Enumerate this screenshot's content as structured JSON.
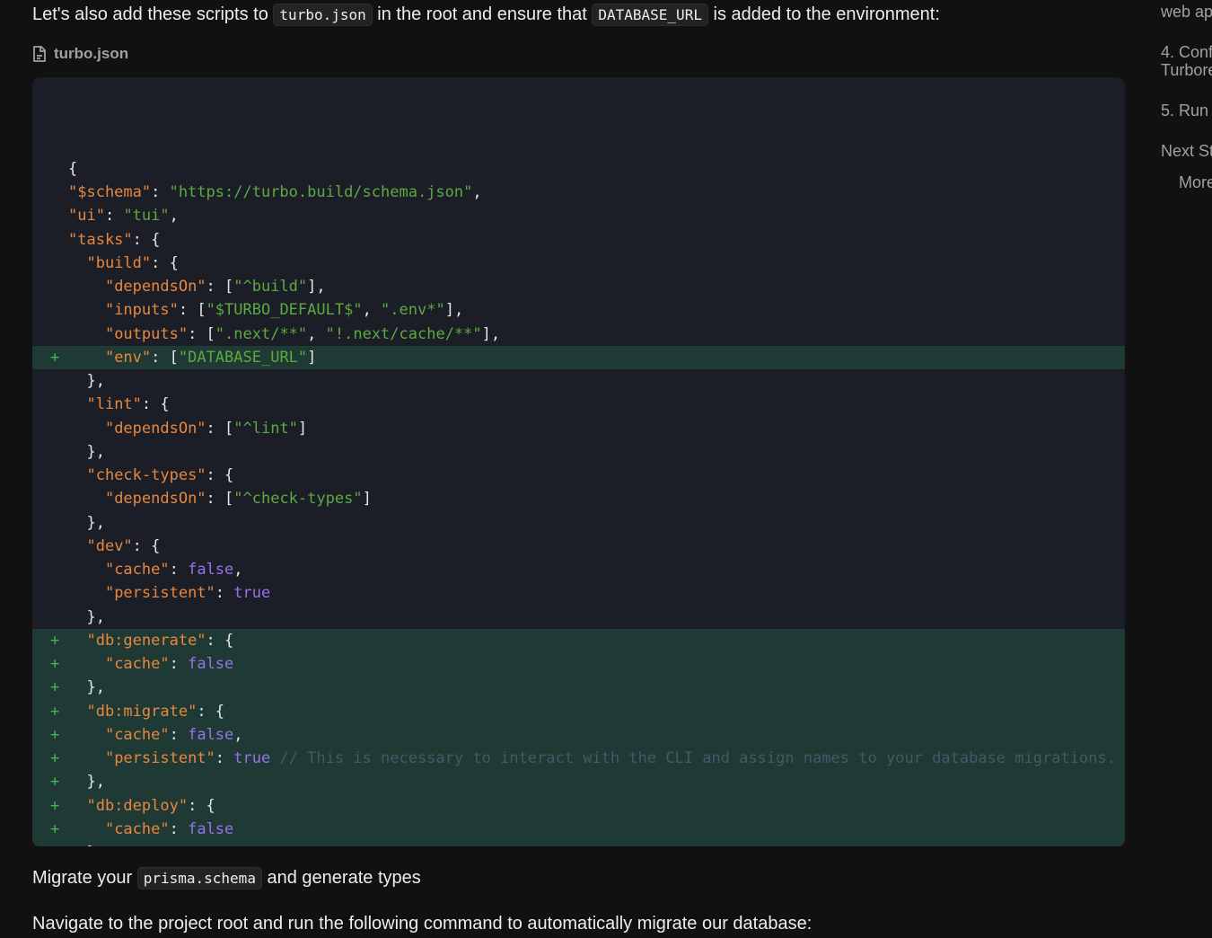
{
  "intro": {
    "before": "Let's also add these scripts to ",
    "code1": "turbo.json",
    "middle": " in the root and ensure that ",
    "code2": "DATABASE_URL",
    "after": " is added to the environment:"
  },
  "file": {
    "icon": "file-icon",
    "name": "turbo.json"
  },
  "code": [
    {
      "added": false,
      "tokens": [
        {
          "t": "p",
          "v": "{"
        }
      ]
    },
    {
      "added": false,
      "tokens": [
        {
          "t": "k",
          "v": "\"$schema\""
        },
        {
          "t": "p",
          "v": ": "
        },
        {
          "t": "s",
          "v": "\"https://turbo.build/schema.json\""
        },
        {
          "t": "p",
          "v": ","
        }
      ]
    },
    {
      "added": false,
      "tokens": [
        {
          "t": "k",
          "v": "\"ui\""
        },
        {
          "t": "p",
          "v": ": "
        },
        {
          "t": "s",
          "v": "\"tui\""
        },
        {
          "t": "p",
          "v": ","
        }
      ]
    },
    {
      "added": false,
      "tokens": [
        {
          "t": "k",
          "v": "\"tasks\""
        },
        {
          "t": "p",
          "v": ": {"
        }
      ]
    },
    {
      "added": false,
      "tokens": [
        {
          "t": "p",
          "v": "  "
        },
        {
          "t": "k",
          "v": "\"build\""
        },
        {
          "t": "p",
          "v": ": {"
        }
      ]
    },
    {
      "added": false,
      "tokens": [
        {
          "t": "p",
          "v": "    "
        },
        {
          "t": "k",
          "v": "\"dependsOn\""
        },
        {
          "t": "p",
          "v": ": ["
        },
        {
          "t": "s",
          "v": "\"^build\""
        },
        {
          "t": "p",
          "v": "],"
        }
      ]
    },
    {
      "added": false,
      "tokens": [
        {
          "t": "p",
          "v": "    "
        },
        {
          "t": "k",
          "v": "\"inputs\""
        },
        {
          "t": "p",
          "v": ": ["
        },
        {
          "t": "s",
          "v": "\"$TURBO_DEFAULT$\""
        },
        {
          "t": "p",
          "v": ", "
        },
        {
          "t": "s",
          "v": "\".env*\""
        },
        {
          "t": "p",
          "v": "],"
        }
      ]
    },
    {
      "added": false,
      "tokens": [
        {
          "t": "p",
          "v": "    "
        },
        {
          "t": "k",
          "v": "\"outputs\""
        },
        {
          "t": "p",
          "v": ": ["
        },
        {
          "t": "s",
          "v": "\".next/**\""
        },
        {
          "t": "p",
          "v": ", "
        },
        {
          "t": "s",
          "v": "\"!.next/cache/**\""
        },
        {
          "t": "p",
          "v": "],"
        }
      ]
    },
    {
      "added": true,
      "tokens": [
        {
          "t": "p",
          "v": "    "
        },
        {
          "t": "k",
          "v": "\"env\""
        },
        {
          "t": "p",
          "v": ": ["
        },
        {
          "t": "s",
          "v": "\"DATABASE_URL\""
        },
        {
          "t": "p",
          "v": "]"
        }
      ]
    },
    {
      "added": false,
      "tokens": [
        {
          "t": "p",
          "v": "  },"
        }
      ]
    },
    {
      "added": false,
      "tokens": [
        {
          "t": "p",
          "v": "  "
        },
        {
          "t": "k",
          "v": "\"lint\""
        },
        {
          "t": "p",
          "v": ": {"
        }
      ]
    },
    {
      "added": false,
      "tokens": [
        {
          "t": "p",
          "v": "    "
        },
        {
          "t": "k",
          "v": "\"dependsOn\""
        },
        {
          "t": "p",
          "v": ": ["
        },
        {
          "t": "s",
          "v": "\"^lint\""
        },
        {
          "t": "p",
          "v": "]"
        }
      ]
    },
    {
      "added": false,
      "tokens": [
        {
          "t": "p",
          "v": "  },"
        }
      ]
    },
    {
      "added": false,
      "tokens": [
        {
          "t": "p",
          "v": "  "
        },
        {
          "t": "k",
          "v": "\"check-types\""
        },
        {
          "t": "p",
          "v": ": {"
        }
      ]
    },
    {
      "added": false,
      "tokens": [
        {
          "t": "p",
          "v": "    "
        },
        {
          "t": "k",
          "v": "\"dependsOn\""
        },
        {
          "t": "p",
          "v": ": ["
        },
        {
          "t": "s",
          "v": "\"^check-types\""
        },
        {
          "t": "p",
          "v": "]"
        }
      ]
    },
    {
      "added": false,
      "tokens": [
        {
          "t": "p",
          "v": "  },"
        }
      ]
    },
    {
      "added": false,
      "tokens": [
        {
          "t": "p",
          "v": "  "
        },
        {
          "t": "k",
          "v": "\"dev\""
        },
        {
          "t": "p",
          "v": ": {"
        }
      ]
    },
    {
      "added": false,
      "tokens": [
        {
          "t": "p",
          "v": "    "
        },
        {
          "t": "k",
          "v": "\"cache\""
        },
        {
          "t": "p",
          "v": ": "
        },
        {
          "t": "kw",
          "v": "false"
        },
        {
          "t": "p",
          "v": ","
        }
      ]
    },
    {
      "added": false,
      "tokens": [
        {
          "t": "p",
          "v": "    "
        },
        {
          "t": "k",
          "v": "\"persistent\""
        },
        {
          "t": "p",
          "v": ": "
        },
        {
          "t": "kw",
          "v": "true"
        }
      ]
    },
    {
      "added": false,
      "tokens": [
        {
          "t": "p",
          "v": "  },"
        }
      ]
    },
    {
      "added": true,
      "tokens": [
        {
          "t": "p",
          "v": "  "
        },
        {
          "t": "k",
          "v": "\"db:generate\""
        },
        {
          "t": "p",
          "v": ": {"
        }
      ]
    },
    {
      "added": true,
      "tokens": [
        {
          "t": "p",
          "v": "    "
        },
        {
          "t": "k",
          "v": "\"cache\""
        },
        {
          "t": "p",
          "v": ": "
        },
        {
          "t": "kw",
          "v": "false"
        }
      ]
    },
    {
      "added": true,
      "tokens": [
        {
          "t": "p",
          "v": "  },"
        }
      ]
    },
    {
      "added": true,
      "tokens": [
        {
          "t": "p",
          "v": "  "
        },
        {
          "t": "k",
          "v": "\"db:migrate\""
        },
        {
          "t": "p",
          "v": ": {"
        }
      ]
    },
    {
      "added": true,
      "tokens": [
        {
          "t": "p",
          "v": "    "
        },
        {
          "t": "k",
          "v": "\"cache\""
        },
        {
          "t": "p",
          "v": ": "
        },
        {
          "t": "kw",
          "v": "false"
        },
        {
          "t": "p",
          "v": ","
        }
      ]
    },
    {
      "added": true,
      "tokens": [
        {
          "t": "p",
          "v": "    "
        },
        {
          "t": "k",
          "v": "\"persistent\""
        },
        {
          "t": "p",
          "v": ": "
        },
        {
          "t": "kw",
          "v": "true"
        },
        {
          "t": "p",
          "v": " "
        },
        {
          "t": "c",
          "v": "// This is necessary to interact with the CLI and assign names to your database migrations."
        }
      ]
    },
    {
      "added": true,
      "tokens": [
        {
          "t": "p",
          "v": "  },"
        }
      ]
    },
    {
      "added": true,
      "tokens": [
        {
          "t": "p",
          "v": "  "
        },
        {
          "t": "k",
          "v": "\"db:deploy\""
        },
        {
          "t": "p",
          "v": ": {"
        }
      ]
    },
    {
      "added": true,
      "tokens": [
        {
          "t": "p",
          "v": "    "
        },
        {
          "t": "k",
          "v": "\"cache\""
        },
        {
          "t": "p",
          "v": ": "
        },
        {
          "t": "kw",
          "v": "false"
        }
      ]
    },
    {
      "added": true,
      "tokens": [
        {
          "t": "p",
          "v": "  }"
        }
      ]
    },
    {
      "added": false,
      "tokens": [
        {
          "t": "p",
          "v": "}"
        }
      ]
    }
  ],
  "diff_marker": "+",
  "migrate": {
    "before": "Migrate your ",
    "code": "prisma.schema",
    "after": " and generate types"
  },
  "navigate": {
    "text": "Navigate to the project root and run the following command to automatically migrate our database:"
  },
  "toc": [
    {
      "label": "web ap"
    },
    {
      "label": "4. Conf"
    },
    {
      "label": "Turbore"
    },
    {
      "label": "5. Run"
    },
    {
      "label": "Next St"
    },
    {
      "label": "More"
    }
  ]
}
